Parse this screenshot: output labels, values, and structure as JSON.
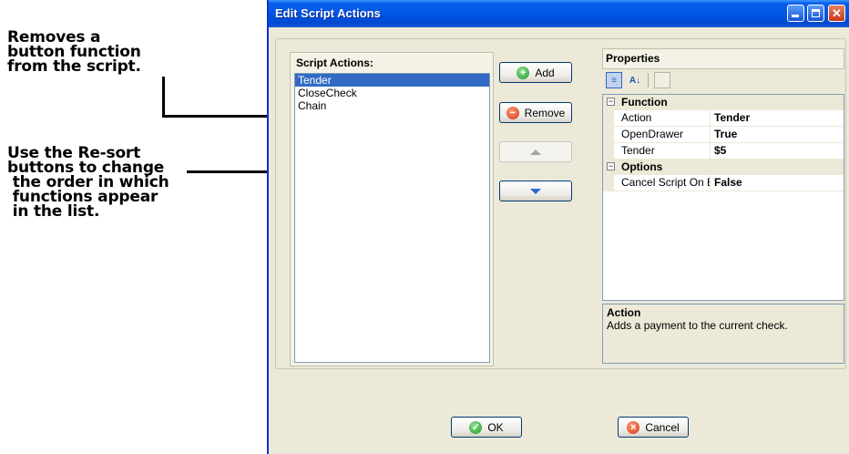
{
  "callouts": {
    "remove_note": "Removes a\nbutton function\nfrom the script.",
    "resort_note": "Use the Re-sort\nbuttons to change\n the order in which\n functions appear\n in the list."
  },
  "window": {
    "title": "Edit Script Actions"
  },
  "script_actions": {
    "label": "Script Actions:",
    "items": [
      "Tender",
      "CloseCheck",
      "Chain"
    ],
    "selected": "Tender"
  },
  "buttons": {
    "add": "Add",
    "remove": "Remove",
    "ok": "OK",
    "cancel": "Cancel"
  },
  "properties": {
    "label": "Properties",
    "categories": [
      {
        "name": "Function",
        "rows": [
          {
            "key": "Action",
            "value": "Tender"
          },
          {
            "key": "OpenDrawer",
            "value": "True"
          },
          {
            "key": "Tender",
            "value": "$5"
          }
        ]
      },
      {
        "name": "Options",
        "rows": [
          {
            "key": "Cancel Script On Err",
            "value": "False"
          }
        ]
      }
    ],
    "description_title": "Action",
    "description_text": "Adds a payment to the current check."
  },
  "colors": {
    "titlebar": "#0055e5",
    "selection": "#316ac5",
    "dialog_bg": "#ece9d8"
  }
}
